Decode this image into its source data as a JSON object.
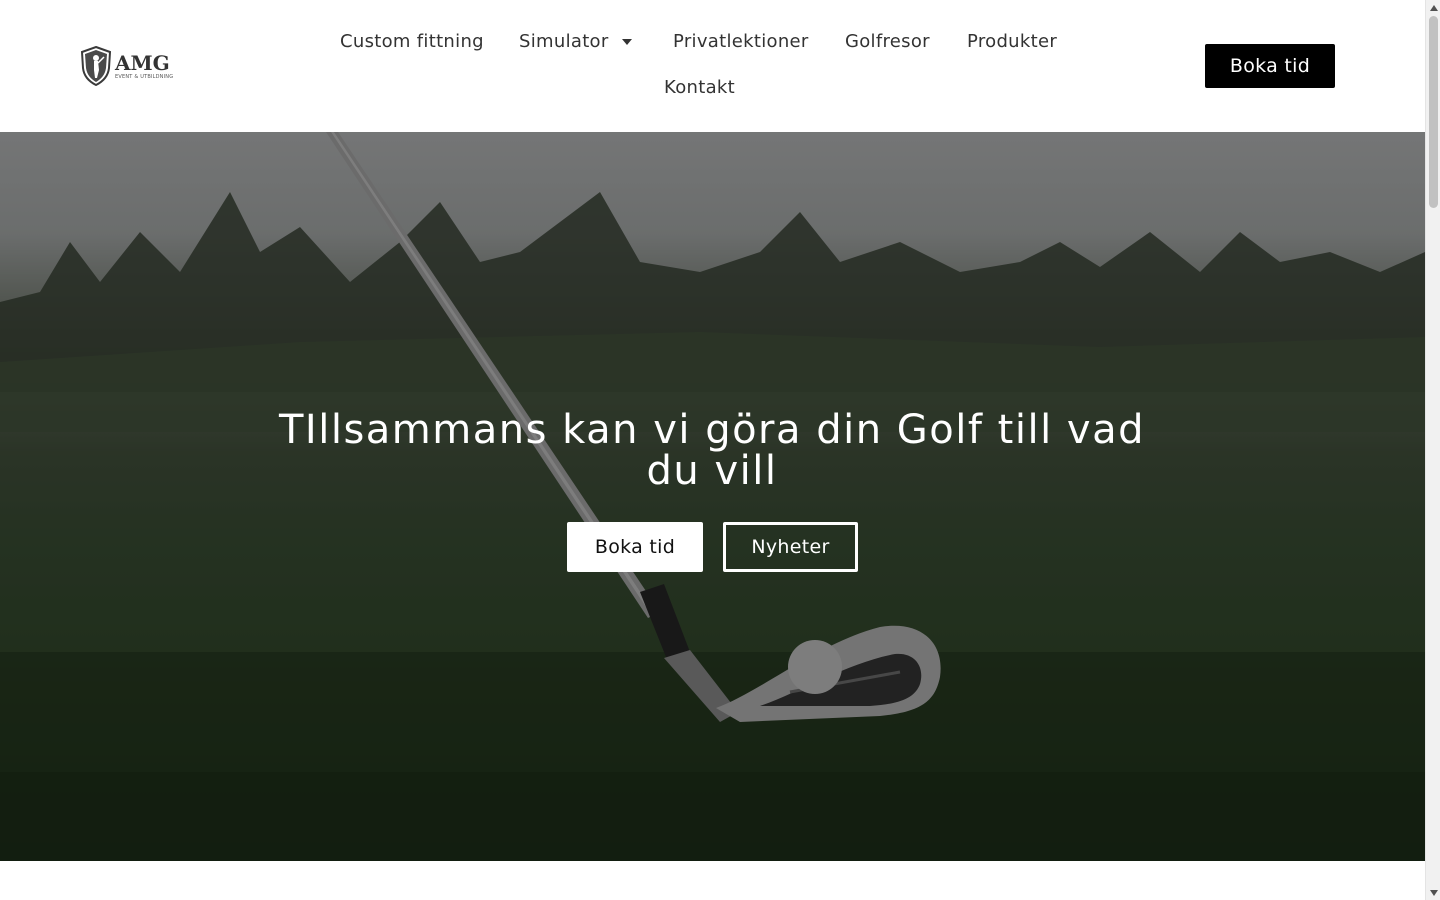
{
  "brand": {
    "name": "AMG",
    "tagline": "EVENT & UTBILDNING"
  },
  "nav": {
    "items": [
      {
        "label": "Custom fittning"
      },
      {
        "label": "Simulator",
        "has_dropdown": true
      },
      {
        "label": "Privatlektioner"
      },
      {
        "label": "Golfresor"
      },
      {
        "label": "Produkter"
      },
      {
        "label": "Kontakt"
      }
    ],
    "cta_label": "Boka tid"
  },
  "hero": {
    "title": "TIllsammans kan vi göra din Golf till vad du vill",
    "primary_button": "Boka tid",
    "secondary_button": "Nyheter"
  },
  "colors": {
    "header_bg": "#ffffff",
    "nav_text": "#333333",
    "cta_bg": "#000000",
    "cta_text": "#ffffff",
    "hero_text": "#ffffff"
  },
  "icons": {
    "dropdown": "caret-down-icon",
    "logo": "shield-golfer-icon"
  }
}
